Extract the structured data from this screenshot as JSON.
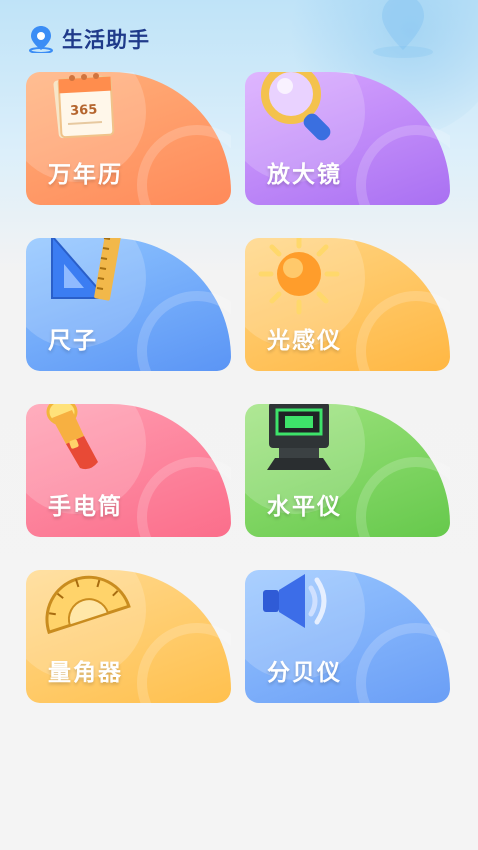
{
  "header": {
    "title": "生活助手",
    "logo_icon": "location-pin-icon"
  },
  "tools": [
    {
      "label": "万年历",
      "icon": "calendar-icon",
      "color": "#ff8a5a"
    },
    {
      "label": "放大镜",
      "icon": "magnifier-icon",
      "color": "#a970f2"
    },
    {
      "label": "尺子",
      "icon": "ruler-icon",
      "color": "#5b95f5"
    },
    {
      "label": "光感仪",
      "icon": "sun-icon",
      "color": "#ffb743"
    },
    {
      "label": "手电筒",
      "icon": "flashlight-icon",
      "color": "#fb6e8b"
    },
    {
      "label": "水平仪",
      "icon": "laser-level-icon",
      "color": "#66c94c"
    },
    {
      "label": "量角器",
      "icon": "protractor-icon",
      "color": "#ffc04e"
    },
    {
      "label": "分贝仪",
      "icon": "speaker-icon",
      "color": "#6a9ef6"
    }
  ],
  "calendar_number": "365"
}
